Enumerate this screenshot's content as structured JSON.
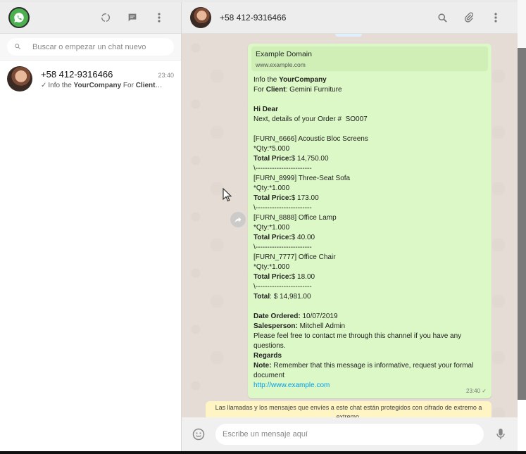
{
  "left_header": {
    "logo_icon": "whatsapp-logo-icon",
    "status_icon": "status-circle-icon",
    "new_chat_icon": "chat-bubble-icon",
    "menu_icon": "vertical-dots-icon"
  },
  "search": {
    "placeholder": "Buscar o empezar un chat nuevo"
  },
  "chat_list": [
    {
      "name": "+58 412-9316466",
      "time": "23:40",
      "preview_prefix": "Info the ",
      "preview_company": "YourCompany",
      "preview_mid": " For ",
      "preview_client": "Client",
      "preview_suffix": "…"
    }
  ],
  "conversation": {
    "contact_name": "+58 412-9316466",
    "header_icons": [
      "search-icon",
      "paperclip-icon",
      "vertical-dots-icon"
    ]
  },
  "message": {
    "link_preview_title": "Example Domain",
    "link_preview_url": "www.example.com",
    "lines": [
      {
        "parts": [
          {
            "t": "Info the "
          },
          {
            "t": "YourCompany",
            "b": true
          }
        ]
      },
      {
        "parts": [
          {
            "t": "For "
          },
          {
            "t": "Client",
            "b": true
          },
          {
            "t": ": Gemini Furniture"
          }
        ]
      },
      {
        "parts": []
      },
      {
        "parts": [
          {
            "t": "Hi Dear",
            "b": true
          }
        ]
      },
      {
        "parts": [
          {
            "t": "Next, details of your Order #  SO007"
          }
        ]
      },
      {
        "parts": []
      },
      {
        "parts": [
          {
            "t": "[FURN_6666] Acoustic Bloc Screens"
          }
        ]
      },
      {
        "parts": [
          {
            "t": "*Qty:*5.000"
          }
        ]
      },
      {
        "parts": [
          {
            "t": "Total Price:",
            "b": true
          },
          {
            "t": "$ 14,750.00"
          }
        ]
      },
      {
        "parts": [
          {
            "t": "\\------------------------"
          }
        ]
      },
      {
        "parts": [
          {
            "t": "[FURN_8999] Three-Seat Sofa"
          }
        ]
      },
      {
        "parts": [
          {
            "t": "*Qty:*1.000"
          }
        ]
      },
      {
        "parts": [
          {
            "t": "Total Price:",
            "b": true
          },
          {
            "t": "$ 173.00"
          }
        ]
      },
      {
        "parts": [
          {
            "t": "\\------------------------"
          }
        ]
      },
      {
        "parts": [
          {
            "t": "[FURN_8888] Office Lamp"
          }
        ]
      },
      {
        "parts": [
          {
            "t": "*Qty:*1.000"
          }
        ]
      },
      {
        "parts": [
          {
            "t": "Total Price:",
            "b": true
          },
          {
            "t": "$ 40.00"
          }
        ]
      },
      {
        "parts": [
          {
            "t": "\\------------------------"
          }
        ]
      },
      {
        "parts": [
          {
            "t": "[FURN_7777] Office Chair"
          }
        ]
      },
      {
        "parts": [
          {
            "t": "*Qty:*1.000"
          }
        ]
      },
      {
        "parts": [
          {
            "t": "Total Price:",
            "b": true
          },
          {
            "t": "$ 18.00"
          }
        ]
      },
      {
        "parts": [
          {
            "t": "\\------------------------"
          }
        ]
      },
      {
        "parts": [
          {
            "t": "Total",
            "b": true
          },
          {
            "t": ": $ 14,981.00"
          }
        ]
      },
      {
        "parts": []
      },
      {
        "parts": [
          {
            "t": "Date Ordered:",
            "b": true
          },
          {
            "t": " 10/07/2019"
          }
        ]
      },
      {
        "parts": [
          {
            "t": "Salesperson:",
            "b": true
          },
          {
            "t": " Mitchell Admin"
          }
        ]
      },
      {
        "parts": [
          {
            "t": "Please feel free to contact me through this channel if you have any"
          }
        ]
      },
      {
        "parts": [
          {
            "t": "questions."
          }
        ]
      },
      {
        "parts": [
          {
            "t": "Regards",
            "b": true
          }
        ]
      },
      {
        "parts": [
          {
            "t": "Note:",
            "b": true
          },
          {
            "t": " Remember that this message is informative, request your formal"
          }
        ]
      },
      {
        "parts": [
          {
            "t": "document"
          }
        ]
      }
    ],
    "link_text": "http://www.example.com",
    "time": "23:40",
    "status": "✓"
  },
  "encryption_notice": "Las llamadas y los mensajes que envíes a este chat están protegidos con cifrado de extremo a extremo.",
  "compose": {
    "placeholder": "Escribe un mensaje aquí",
    "emoji_icon": "emoji-icon",
    "mic_icon": "microphone-icon"
  }
}
